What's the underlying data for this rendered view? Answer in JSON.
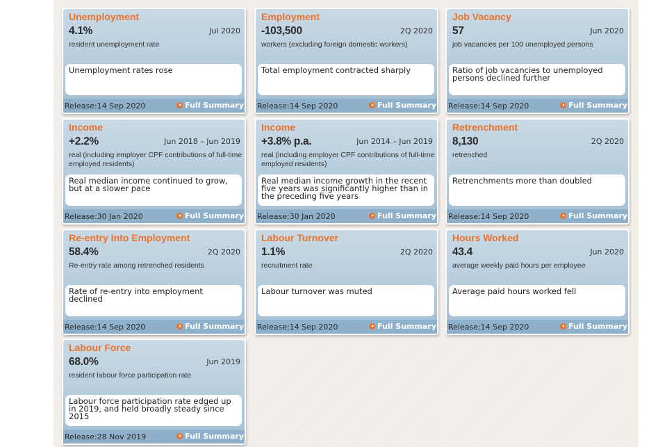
{
  "colors": {
    "title": "#e8732d",
    "card_top": "#c9d9e5",
    "card_bottom": "#a0bdd3",
    "footer": "#8fb0ca",
    "background": "#f1ece7"
  },
  "release_prefix": "Release:",
  "link_label": "Full Summary",
  "link_icon": "play-circle-icon",
  "cards": [
    {
      "title": "Unemployment",
      "value": "4.1%",
      "period": "Jul 2020",
      "description": "resident unemployment rate",
      "summary": "Unemployment rates rose",
      "release": "Release:14 Sep 2020"
    },
    {
      "title": "Employment",
      "value": "-103,500",
      "period": "2Q 2020",
      "description": "workers (excluding foreign domestic workers)",
      "summary": "Total employment contracted sharply",
      "release": "Release:14 Sep 2020"
    },
    {
      "title": "Job Vacancy",
      "value": "57",
      "period": "Jun 2020",
      "description": "job vacancies per 100 unemployed persons",
      "summary": "Ratio of job vacancies to unemployed persons declined further",
      "release": "Release:14 Sep 2020"
    },
    {
      "title": "Income",
      "value": "+2.2%",
      "period": "Jun 2018 – Jun 2019",
      "description": "real (including employer CPF contributions of full-time employed residents)",
      "summary": "Real median income continued to grow, but at a slower pace",
      "release": "Release:30 Jan 2020"
    },
    {
      "title": "Income",
      "value": "+3.8% p.a.",
      "period": "Jun 2014 – Jun 2019",
      "description": "real (including employer CPF contributions of full-time employed residents)",
      "summary": "Real median income growth in the recent five years was significantly higher than in the preceding five years",
      "release": "Release:30 Jan 2020"
    },
    {
      "title": "Retrenchment",
      "value": "8,130",
      "period": "2Q 2020",
      "description": "retrenched",
      "summary": "Retrenchments more than doubled",
      "release": "Release:14 Sep 2020"
    },
    {
      "title": "Re-entry Into Employment",
      "value": "58.4%",
      "period": "2Q 2020",
      "description": "Re-entry rate among retrenched residents",
      "summary": "Rate of re-entry into employment declined",
      "release": "Release:14 Sep 2020"
    },
    {
      "title": "Labour Turnover",
      "value": "1.1%",
      "period": "2Q 2020",
      "description": "recruitment rate",
      "summary": "Labour turnover was muted",
      "release": "Release:14 Sep 2020"
    },
    {
      "title": "Hours Worked",
      "value": "43.4",
      "period": "Jun 2020",
      "description": "average weekly paid hours per employee",
      "summary": "Average paid hours worked fell",
      "release": "Release:14 Sep 2020"
    },
    {
      "title": "Labour Force",
      "value": "68.0%",
      "period": "Jun 2019",
      "description": "resident labour force participation rate",
      "summary": "Labour force participation rate edged up in 2019, and held broadly steady since 2015",
      "release": "Release:28 Nov 2019"
    }
  ]
}
